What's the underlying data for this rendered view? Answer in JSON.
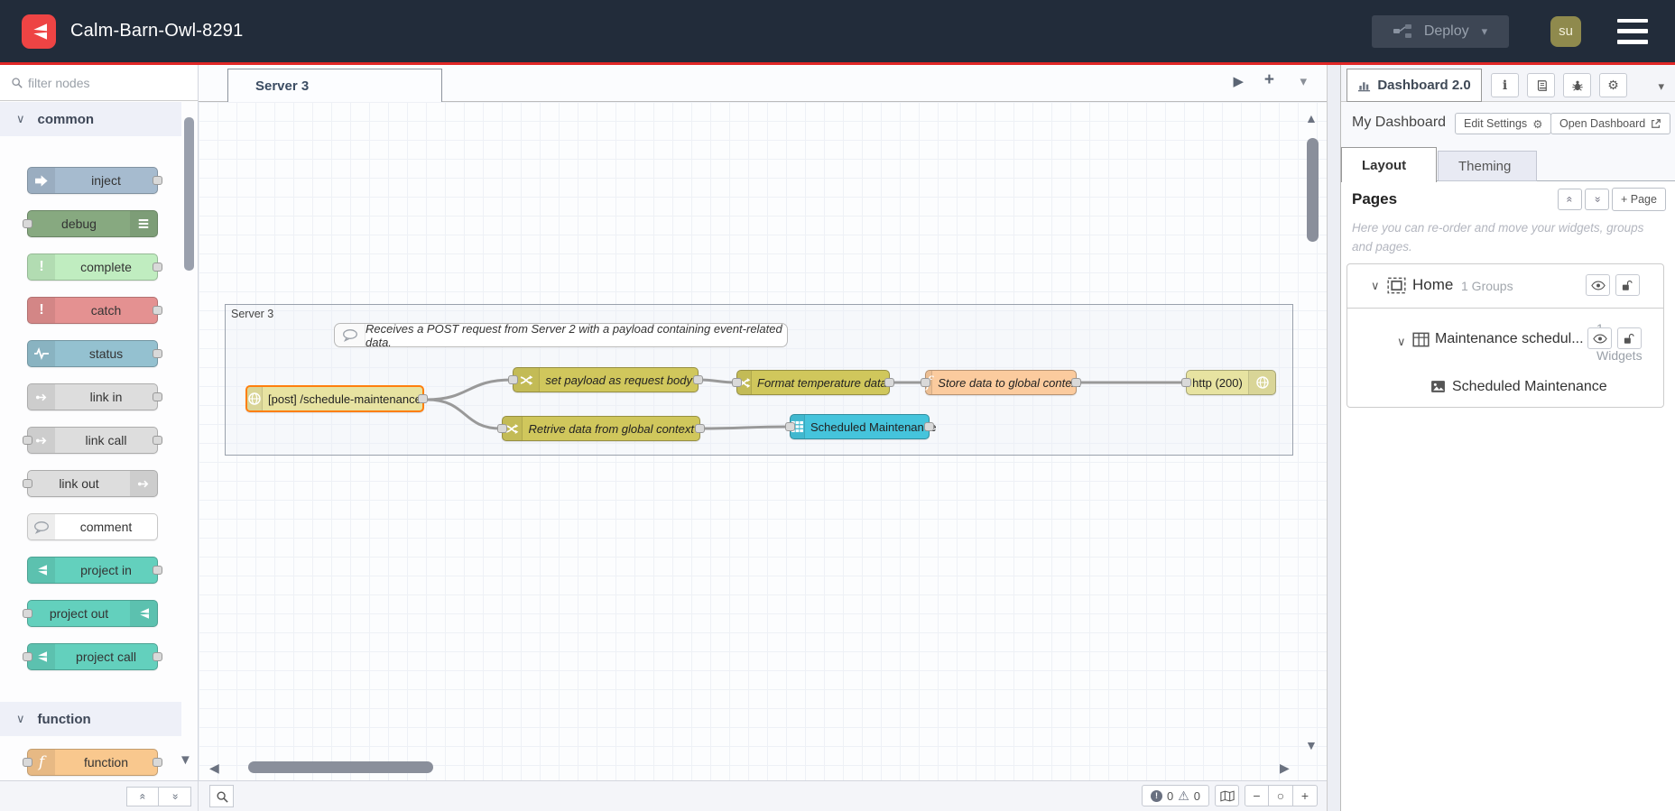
{
  "header": {
    "title": "Calm-Barn-Owl-8291",
    "deploy_label": "Deploy",
    "avatar_text": "su"
  },
  "colors": {
    "header_bg": "#222c3a",
    "accent_red": "#e12726",
    "logo_red": "#ee4444",
    "deploy_bg": "#3d4654",
    "deploy_text": "#98a1ad",
    "avatar_bg": "#8f8a4d",
    "selection_orange": "#ff7f0e",
    "wire": "#999999",
    "node_inject": "#a6bbcf",
    "node_debug": "#87a980",
    "node_complete": "#c0edc0",
    "node_catch": "#e49191",
    "node_status": "#94c1d0",
    "node_link": "#dddddd",
    "node_comment": "#ffffff",
    "node_project": "#63d0bd",
    "node_function": "#f9c88e",
    "node_change": "#d0c75c",
    "node_function_flow": "#fbcb9e",
    "node_http": "#e7e3a1",
    "node_table": "#45c4dc"
  },
  "icons": {
    "caret_down": "▾",
    "play": "▶",
    "plus": "+",
    "scroll_up": "▲",
    "scroll_down": "▼",
    "scroll_left": "◀",
    "scroll_right": "▶",
    "zoom_out": "−",
    "zoom_reset": "○",
    "zoom_in": "+",
    "chevron_down": "∨",
    "double_chevron": "«",
    "bang": "!",
    "info": "i",
    "gear": "⚙",
    "warning": "⚠"
  },
  "palette": {
    "filter_placeholder": "filter nodes",
    "sections": [
      {
        "label": "common",
        "items": [
          {
            "label": "inject"
          },
          {
            "label": "debug"
          },
          {
            "label": "complete"
          },
          {
            "label": "catch"
          },
          {
            "label": "status"
          },
          {
            "label": "link in"
          },
          {
            "label": "link call"
          },
          {
            "label": "link out"
          },
          {
            "label": "comment"
          },
          {
            "label": "project in"
          },
          {
            "label": "project out"
          },
          {
            "label": "project call"
          }
        ]
      },
      {
        "label": "function",
        "items": [
          {
            "label": "function"
          }
        ]
      }
    ]
  },
  "workspace": {
    "tab_label": "Server 3",
    "group_label": "Server 3",
    "comment_text": "Receives a POST request from Server 2 with a payload containing event-related data.",
    "nodes": [
      {
        "label": "[post] /schedule-maintenance"
      },
      {
        "label": "set payload as request body"
      },
      {
        "label": "Format temperature data."
      },
      {
        "label": "Store data to global context"
      },
      {
        "label": "http (200)"
      },
      {
        "label": "Retrive data from global context"
      },
      {
        "label": "Scheduled Maintenance"
      }
    ],
    "status": {
      "errors": "0",
      "warnings": "0"
    }
  },
  "sidebar": {
    "tab_label": "Dashboard 2.0",
    "dashboard_name": "My Dashboard",
    "edit_settings_label": "Edit Settings",
    "open_dashboard_label": "Open Dashboard",
    "tab_layout": "Layout",
    "tab_theming": "Theming",
    "pages_title": "Pages",
    "add_page_label": "+ Page",
    "help_text": "Here you can re-order and move your widgets, groups and pages.",
    "tree": {
      "page_name": "Home",
      "page_meta": "1 Groups",
      "group_name": "Maintenance schedul...",
      "group_meta": "1 Widgets",
      "widget_name": "Scheduled Maintenance"
    }
  }
}
